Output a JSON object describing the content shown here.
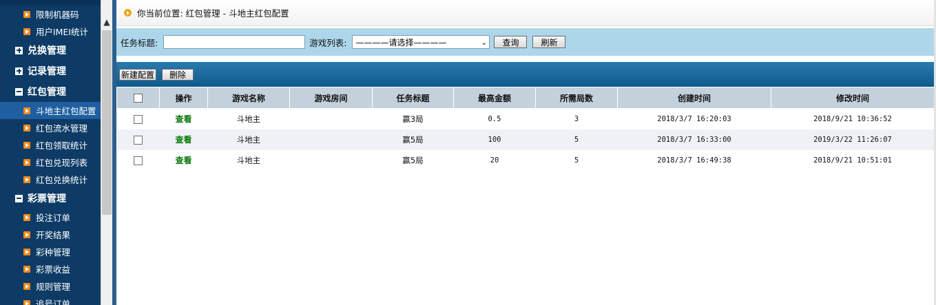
{
  "sidebar": {
    "groups": [
      {
        "label": null,
        "items": [
          {
            "label": "限制机器码"
          },
          {
            "label": "用户IMEI统计"
          }
        ]
      },
      {
        "label": "兑换管理",
        "expanded": false,
        "items": []
      },
      {
        "label": "记录管理",
        "expanded": false,
        "items": []
      },
      {
        "label": "红包管理",
        "expanded": true,
        "items": [
          {
            "label": "斗地主红包配置",
            "active": true
          },
          {
            "label": "红包流水管理"
          },
          {
            "label": "红包领取统计"
          },
          {
            "label": "红包兑现列表"
          },
          {
            "label": "红包兑换统计"
          }
        ]
      },
      {
        "label": "彩票管理",
        "expanded": true,
        "items": [
          {
            "label": "投注订单"
          },
          {
            "label": "开奖结果"
          },
          {
            "label": "彩种管理"
          },
          {
            "label": "彩票收益"
          },
          {
            "label": "规则管理"
          },
          {
            "label": "追号订单"
          }
        ]
      }
    ]
  },
  "breadcrumb": {
    "text": "你当前位置: 红包管理 - 斗地主红包配置"
  },
  "search": {
    "title_label": "任务标题:",
    "title_value": "",
    "game_label": "游戏列表:",
    "game_selected": "————请选择————",
    "query_button": "查询",
    "refresh_button": "刷新"
  },
  "toolbar": {
    "new_button": "新建配置",
    "delete_button": "删除"
  },
  "table": {
    "columns": [
      "操作",
      "游戏名称",
      "游戏房间",
      "任务标题",
      "最高金额",
      "所需局数",
      "创建时间",
      "修改时间"
    ],
    "rows": [
      {
        "action": "查看",
        "game": "斗地主",
        "room": "",
        "task": "赢3局",
        "max_amount": "0.5",
        "rounds": "3",
        "created": "2018/3/7 16:20:03",
        "modified": "2018/9/21 10:36:52"
      },
      {
        "action": "查看",
        "game": "斗地主",
        "room": "",
        "task": "赢5局",
        "max_amount": "100",
        "rounds": "5",
        "created": "2018/3/7 16:33:00",
        "modified": "2019/3/22 11:26:07"
      },
      {
        "action": "查看",
        "game": "斗地主",
        "room": "",
        "task": "赢5局",
        "max_amount": "20",
        "rounds": "5",
        "created": "2018/3/7 16:49:38",
        "modified": "2018/9/21 10:51:01"
      }
    ]
  },
  "colors": {
    "sidebar_bg": "#0d3b66",
    "sidebar_active": "#1f5fa0",
    "search_bar": "#add6ea",
    "toolbar": "#0f5a8c",
    "table_header": "#c3d1dc",
    "link_green": "#0b7a0b"
  }
}
